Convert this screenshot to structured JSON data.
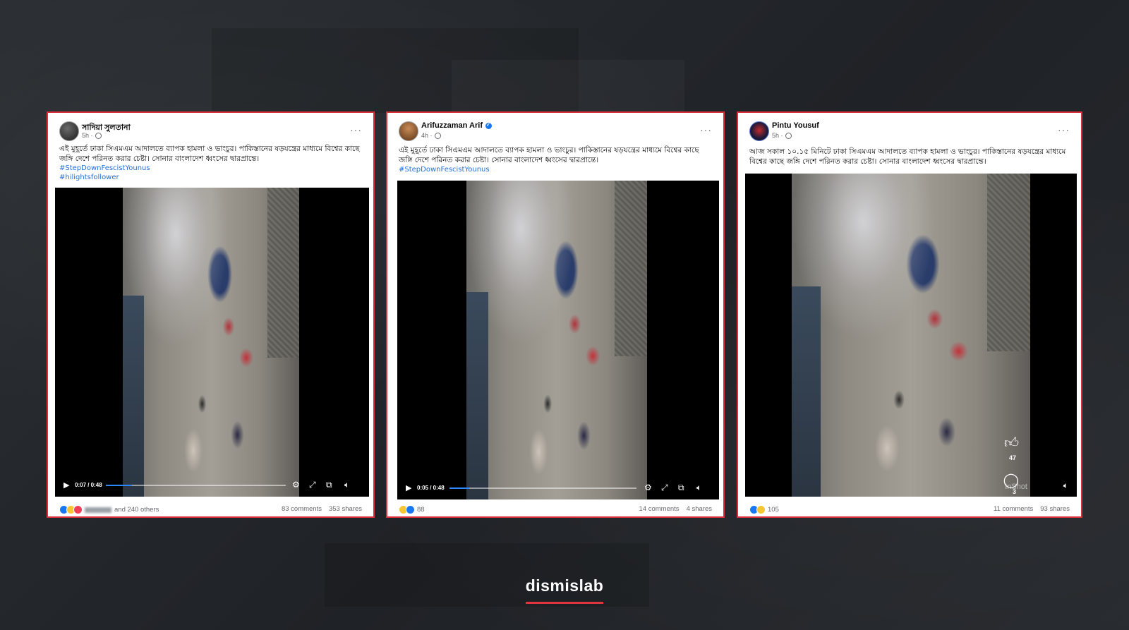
{
  "posts": [
    {
      "author": "সাদিয়া সুলতানা",
      "meta": "5h ·",
      "text": "এই মুহূর্তে ঢাকা সিএমএম আদালতে ব্যাপক হামলা ও ভাংচুর। পাকিস্তানের ষড়যন্ত্রের মাধ্যমে বিশ্বের কাছে জঙ্গি দেশে পরিনত করার চেষ্টা। সোনার বাংলাদেশ ধ্বংসের দ্বারপ্রান্তে।",
      "hashtags": [
        "#StepDownFescistYounus",
        "#hilightsfollower"
      ],
      "time": "0:07 / 0:48",
      "progress_fraction": 0.146,
      "reaction_text": "and 240 others",
      "comments": "83 comments",
      "shares": "353 shares"
    },
    {
      "author": "Arifuzzaman Arif",
      "meta": "4h ·",
      "text": "এই মুহূর্তে ঢাকা সিএমএম আদালতে ব্যাপক হামলা ও ভাংচুর। পাকিস্তানের ষড়যন্ত্রের মাধ্যমে বিশ্বের কাছে জঙ্গি দেশে পরিনত করার চেষ্টা। সোনার বাংলাদেশ ধ্বংসের দ্বারপ্রান্তে।",
      "hashtags": [
        "#StepDownFescistYounus"
      ],
      "time": "0:05 / 0:48",
      "progress_fraction": 0.104,
      "reaction_text": "88",
      "comments": "14 comments",
      "shares": "4 shares"
    },
    {
      "author": "Pintu Yousuf",
      "meta": "5h ·",
      "text": "আজ সকাল ১০.১৫ মিনিটে ঢাকা সিএমএম আদালতে ব্যাপক হামলা ও ভাংচুর। পাকিস্তানের ষড়যন্ত্রের মাধ্যমে বিশ্বের কাছে জঙ্গি দেশে পরিনত করার চেষ্টা। সোনার বাংলাদেশ ধ্বংসের দ্বারপ্রান্তে।",
      "hashtags": [],
      "like_overlay_count": "47",
      "comment_overlay_count": "3",
      "watermark": "InShot",
      "reaction_text": "105",
      "comments": "11 comments",
      "shares": "93 shares"
    }
  ],
  "brand": {
    "logo_text": "dismislab",
    "accent_color": "#e0343f"
  },
  "icons": {
    "more": "more-options-icon",
    "play": "play-icon",
    "settings": "settings-icon",
    "fullscreen": "fullscreen-icon",
    "pip": "picture-in-picture-icon",
    "volume": "volume-icon",
    "like": "thumbs-up-icon",
    "comment": "comment-bubble-icon"
  }
}
